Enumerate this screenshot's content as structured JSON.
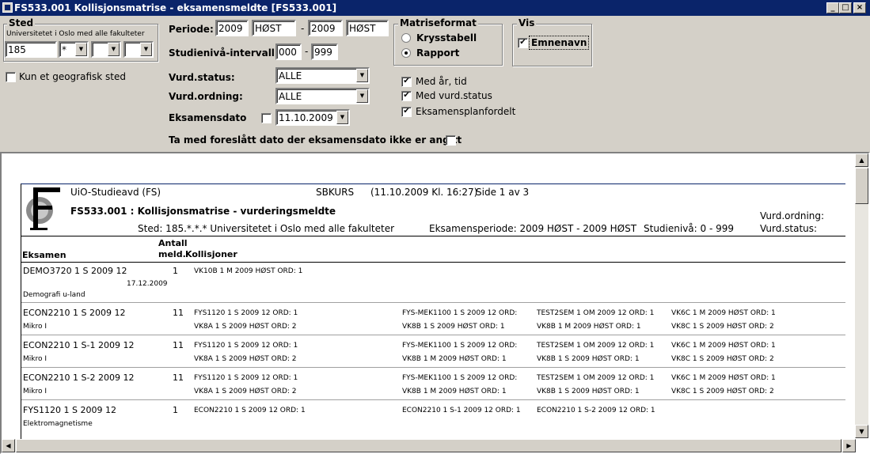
{
  "window": {
    "title": "FS533.001 Kollisjonsmatrise - eksamensmeldte [FS533.001]",
    "buttons": [
      "_",
      "□",
      "×"
    ]
  },
  "sted": {
    "group_label": "Sted",
    "subtitle": "Universitetet i Oslo med alle fakulteter",
    "code": "185",
    "sub1": "*",
    "sub2": "",
    "sub3": ""
  },
  "geo_checkbox": {
    "label": "Kun et geografisk sted",
    "checked": false
  },
  "periode": {
    "label": "Periode:",
    "from_year": "2009",
    "from_term": "HØST",
    "to_year": "2009",
    "to_term": "HØST",
    "sep": "-"
  },
  "studieniva": {
    "label": "Studienivå-intervall:",
    "from": "000",
    "to": "999",
    "sep": "-"
  },
  "vurd_status": {
    "label": "Vurd.status:",
    "value": "ALLE"
  },
  "vurd_ordning": {
    "label": "Vurd.ordning:",
    "value": "ALLE"
  },
  "eksamensdato": {
    "label": "Eksamensdato",
    "checked": false,
    "value": "11.10.2009"
  },
  "foreslatt": {
    "label": "Ta med foreslått dato der eksamensdato ikke er angitt",
    "checked": false
  },
  "matriseformat": {
    "group_label": "Matriseformat",
    "options": [
      {
        "label": "Krysstabell",
        "selected": false
      },
      {
        "label": "Rapport",
        "selected": true
      }
    ]
  },
  "vis": {
    "group_label": "Vis",
    "emnenavn_label": "Emnenavn",
    "emnenavn_checked": true
  },
  "options": {
    "med_ar_tid": {
      "label": "Med år, tid",
      "checked": true
    },
    "med_vurd_status": {
      "label": "Med vurd.status",
      "checked": true
    },
    "eksamensplanfordelt": {
      "label": "Eksamensplanfordelt",
      "checked": true
    }
  },
  "report": {
    "org": "UiO-Studieavd (FS)",
    "job": "SBKURS",
    "timestamp": "(11.10.2009 Kl. 16:27)",
    "page": "Side 1 av 3",
    "title": "FS533.001 : Kollisjonsmatrise - vurderingsmeldte",
    "sted_line": "Sted: 185.*.*.* Universitetet i Oslo med alle fakulteter",
    "periode_line": "Eksamensperiode:  2009 HØST - 2009 HØST",
    "niva_line": "Studienivå:  0 - 999",
    "vurd_ordning": "Vurd.ordning:",
    "vurd_status": "Vurd.status:",
    "col_eksamen": "Eksamen",
    "col_antall": "Antall",
    "col_meld": "meld.",
    "col_kollisjoner": "Kollisjoner",
    "rows": [
      {
        "exam": "DEMO3720 1 S 2009 12",
        "count": "1",
        "date": "17.12.2009",
        "name": "Demografi u-land",
        "line1": [
          "VK10B 1 M 2009 HØST ORD: 1",
          "",
          "",
          ""
        ],
        "line2": [
          "",
          "",
          "",
          ""
        ]
      },
      {
        "exam": "ECON2210 1 S 2009 12",
        "count": "11",
        "date": "",
        "name": "Mikro I",
        "line1": [
          "FYS1120 1 S 2009 12 ORD: 1",
          "FYS-MEK1100 1 S 2009 12 ORD:",
          "TEST2SEM 1 OM 2009 12 ORD: 1",
          "VK6C 1 M 2009 HØST ORD: 1"
        ],
        "line2": [
          "VK8A 1 S 2009 HØST ORD: 2",
          "VK8B 1 S 2009 HØST ORD: 1",
          "VK8B 1 M 2009 HØST ORD: 1",
          "VK8C 1 S 2009 HØST ORD: 2"
        ]
      },
      {
        "exam": "ECON2210 1 S-1 2009 12",
        "count": "11",
        "date": "",
        "name": "Mikro I",
        "line1": [
          "FYS1120 1 S 2009 12 ORD: 1",
          "FYS-MEK1100 1 S 2009 12 ORD:",
          "TEST2SEM 1 OM 2009 12 ORD: 1",
          "VK6C 1 M 2009 HØST ORD: 1"
        ],
        "line2": [
          "VK8A 1 S 2009 HØST ORD: 2",
          "VK8B 1 M 2009 HØST ORD: 1",
          "VK8B 1 S 2009 HØST ORD: 1",
          "VK8C 1 S 2009 HØST ORD: 2"
        ]
      },
      {
        "exam": "ECON2210 1 S-2 2009 12",
        "count": "11",
        "date": "",
        "name": "Mikro I",
        "line1": [
          "FYS1120 1 S 2009 12 ORD: 1",
          "FYS-MEK1100 1 S 2009 12 ORD:",
          "TEST2SEM 1 OM 2009 12 ORD: 1",
          "VK6C 1 M 2009 HØST ORD: 1"
        ],
        "line2": [
          "VK8A 1 S 2009 HØST ORD: 2",
          "VK8B 1 M 2009 HØST ORD: 1",
          "VK8B 1 S 2009 HØST ORD: 1",
          "VK8C 1 S 2009 HØST ORD: 2"
        ]
      },
      {
        "exam": "FYS1120 1 S 2009 12",
        "count": "1",
        "date": "",
        "name": "Elektromagnetisme",
        "line1": [
          "ECON2210 1 S 2009 12 ORD: 1",
          "ECON2210 1 S-1 2009 12 ORD: 1",
          "ECON2210 1 S-2 2009 12 ORD: 1",
          ""
        ],
        "line2": [
          "",
          "",
          "",
          ""
        ]
      }
    ]
  }
}
